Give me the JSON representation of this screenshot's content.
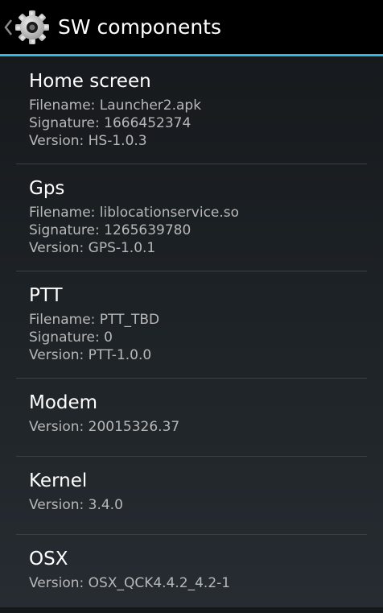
{
  "action_bar": {
    "title": "SW components",
    "icon": "gear-icon",
    "up_icon": "chevron-left-icon",
    "accent_color": "#33b5e5"
  },
  "components": [
    {
      "name": "Home screen",
      "filename": "Filename: Launcher2.apk",
      "signature": "Signature: 1666452374",
      "version": "Version: HS-1.0.3"
    },
    {
      "name": "Gps",
      "filename": "Filename: liblocationservice.so",
      "signature": "Signature: 1265639780",
      "version": "Version: GPS-1.0.1"
    },
    {
      "name": "PTT",
      "filename": "Filename: PTT_TBD",
      "signature": "Signature: 0",
      "version": "Version: PTT-1.0.0"
    },
    {
      "name": "Modem",
      "version": "Version: 20015326.37"
    },
    {
      "name": "Kernel",
      "version": "Version: 3.4.0"
    },
    {
      "name": "OSX",
      "version": "Version: OSX_QCK4.4.2_4.2-1"
    }
  ]
}
